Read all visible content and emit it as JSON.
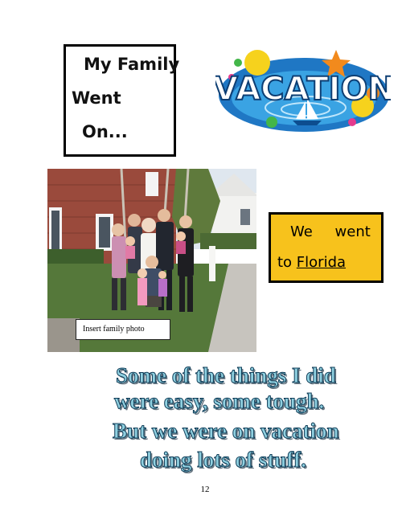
{
  "title_box": {
    "line1": "My Family",
    "line2": "Went",
    "line3": "On..."
  },
  "logo": {
    "text": "VACATION",
    "colors": {
      "blue": "#1f77c4",
      "orange": "#f28a1d",
      "yellow": "#f6d21d"
    }
  },
  "photo": {
    "caption": "Insert family photo"
  },
  "destination": {
    "lead": "We went",
    "prefix": "to ",
    "place": "Florida",
    "bg_color": "#f7c21c"
  },
  "story": {
    "lines": [
      "Some of the things I did",
      "were easy, some tough.",
      "But we were on vacation",
      "doing lots of stuff."
    ],
    "fill_color": "#8fd0e0",
    "outline_color": "#0f3c57"
  },
  "page_number": "12"
}
